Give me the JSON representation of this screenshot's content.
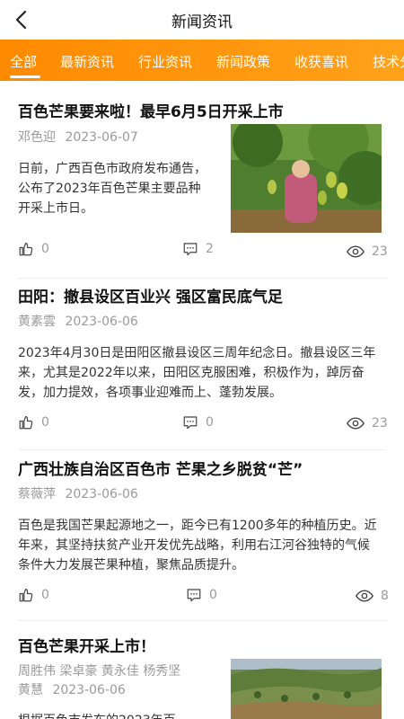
{
  "header": {
    "title": "新闻资讯"
  },
  "tabs": [
    "全部",
    "最新资讯",
    "行业资讯",
    "新闻政策",
    "收获喜讯",
    "技术分享"
  ],
  "articles": [
    {
      "title": "百色芒果要来啦！最早6月5日开采上市",
      "author": "邓色迎",
      "date": "2023-06-07",
      "summary": "日前，广西百色市政府发布通告，公布了2023年百色芒果主要品种开采上市日。",
      "likes": "0",
      "comments": "2",
      "views": "23"
    },
    {
      "title": "田阳：撤县设区百业兴 强区富民底气足",
      "author": "黄素雲",
      "date": "2023-06-06",
      "summary": "2023年4月30日是田阳区撤县设区三周年纪念日。撤县设区三年来，尤其是2022年以来，田阳区克服困难，积极作为，踔厉奋发，加力提效，各项事业迎难而上、蓬勃发展。",
      "likes": "0",
      "comments": "0",
      "views": "23"
    },
    {
      "title": "广西壮族自治区百色市 芒果之乡脱贫“芒”",
      "author": "蔡薇萍",
      "date": "2023-06-06",
      "summary": "百色是我国芒果起源地之一，距今已有1200多年的种植历史。近年来，其坚持扶贫产业开发优先战略，利用右江河谷独特的气候条件大力发展芒果种植，聚焦品质提升。",
      "likes": "0",
      "comments": "0",
      "views": "8"
    },
    {
      "title": "百色芒果开采上市！",
      "authors_line1": "周胜伟 梁卓豪 黄永佳 杨秀坚",
      "authors_line2": "黄慧",
      "date": "2023-06-06",
      "summary": "根据百色市发布的2023年百"
    }
  ]
}
